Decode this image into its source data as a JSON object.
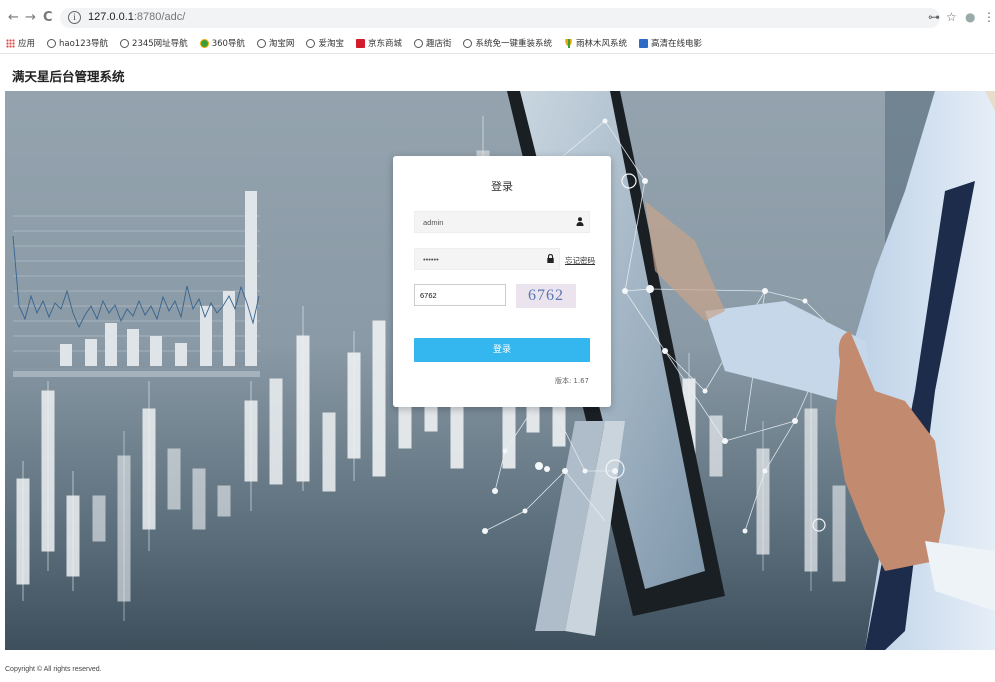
{
  "browser": {
    "nav": {
      "back": "←",
      "forward": "→",
      "reload": "C"
    },
    "omnibox": {
      "info_glyph": "i",
      "host": "127.0.0.1",
      "path": ":8780/adc/"
    },
    "right_icons": {
      "key": "⊶",
      "star": "☆",
      "profile": "●",
      "menu": "⋮"
    },
    "bookmarks": [
      {
        "label": "应用",
        "icon": "apps-icon"
      },
      {
        "label": "hao123导航",
        "icon": "globe-icon"
      },
      {
        "label": "2345网址导航",
        "icon": "globe-icon"
      },
      {
        "label": "360导航",
        "icon": "360-icon"
      },
      {
        "label": "淘宝网",
        "icon": "globe-icon"
      },
      {
        "label": "爱淘宝",
        "icon": "globe-icon"
      },
      {
        "label": "京东商城",
        "icon": "jd-icon"
      },
      {
        "label": "趣店街",
        "icon": "globe-icon"
      },
      {
        "label": "系统免一键重装系统",
        "icon": "globe-icon"
      },
      {
        "label": "雨林木风系统",
        "icon": "tree-icon"
      },
      {
        "label": "高清在线电影",
        "icon": "movie-icon"
      }
    ]
  },
  "app": {
    "title": "满天星后台管理系统"
  },
  "login": {
    "title": "登录",
    "username_value": "admin",
    "password_value": "••••••",
    "forgot_label": "忘记密码",
    "captcha_input_value": "6762",
    "captcha_code": "6762",
    "submit_label": "登录",
    "version_label": "版本:",
    "version_value": "1.67"
  },
  "footer": {
    "copyright": "Copyright © All rights reserved."
  },
  "colors": {
    "accent": "#33b7ee",
    "hero_bg": "#8a9aa6"
  }
}
